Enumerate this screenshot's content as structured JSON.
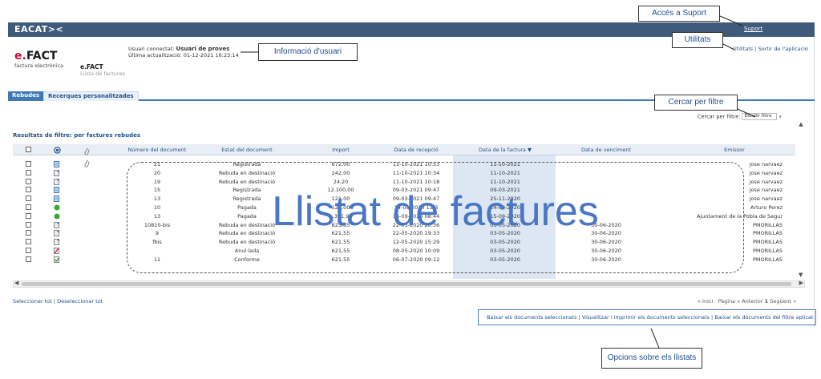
{
  "header": {
    "brand": "EACAT><",
    "support_link": "Suport"
  },
  "app": {
    "logo_main": "FACT",
    "logo_e": "e.",
    "logo_sub": "factura electrònica",
    "app_name": "e.FACT",
    "page_subtitle": "Llista de factures"
  },
  "user_info": {
    "connected_label": "Usuari connectat:",
    "connected_user": "Usuari de proves",
    "last_update_label": "Última actualització:",
    "last_update_value": "01-12-2021 16:23:14"
  },
  "utilities": {
    "utilitats": "Utilitats",
    "separator": "|",
    "logout": "Sortir de l'aplicació"
  },
  "tabs": [
    {
      "label": "Rebudes"
    },
    {
      "label": "Recerques personalitzades"
    }
  ],
  "filter": {
    "label": "Cercar per filtre:",
    "selected": "Escollir filtre"
  },
  "results_title": "Resultats de filtre: per factures rebudes",
  "table": {
    "columns": [
      "Número del document",
      "Estat del document",
      "Import",
      "Data de recepció",
      "Data de la factura",
      "Data de venciment",
      "Emissor"
    ],
    "sort_indicator": "▼",
    "rows": [
      {
        "num": "21",
        "estat": "Registrada",
        "import": "672,00",
        "recepcio": "11-10-2021 10:53",
        "factura": "11-10-2021",
        "venciment": "",
        "emissor": "jose narvaez"
      },
      {
        "num": "20",
        "estat": "Rebuda en destinació",
        "import": "242,00",
        "recepcio": "11-10-2021 10:34",
        "factura": "11-10-2021",
        "venciment": "",
        "emissor": "jose narvaez"
      },
      {
        "num": "19",
        "estat": "Rebuda en destinació",
        "import": "24,20",
        "recepcio": "11-10-2021 10:18",
        "factura": "11-10-2021",
        "venciment": "",
        "emissor": "jose narvaez"
      },
      {
        "num": "15",
        "estat": "Registrada",
        "import": "12.100,00",
        "recepcio": "09-03-2021 09:47",
        "factura": "09-03-2021",
        "venciment": "",
        "emissor": "jose narvaez"
      },
      {
        "num": "13",
        "estat": "Registrada",
        "import": "121,00",
        "recepcio": "09-03-2021 09:47",
        "factura": "25-11-2020",
        "venciment": "",
        "emissor": "jose narvaez"
      },
      {
        "num": "10",
        "estat": "Pagada",
        "import": "121,00",
        "recepcio": "14-09-2020 11:3",
        "factura": "14-09-2020",
        "venciment": "",
        "emissor": "Arturo Perez"
      },
      {
        "num": "13",
        "estat": "Pagada",
        "import": "1.331,92",
        "recepcio": "16-09-2020 08:44",
        "factura": "15-09-2020",
        "venciment": "",
        "emissor": "Ajuntament de la Pobla de Segur"
      },
      {
        "num": "10810-bis",
        "estat": "Rebuda en destinació",
        "import": "823,85",
        "recepcio": "22-05-2020 20:36",
        "factura": "03-05-2020",
        "venciment": "30-06-2020",
        "emissor": "PMORILLAS"
      },
      {
        "num": "9",
        "estat": "Rebuda en destinació",
        "import": "621,55",
        "recepcio": "22-05-2020 19:33",
        "factura": "03-05-2020",
        "venciment": "30-06-2020",
        "emissor": "PMORILLAS"
      },
      {
        "num": "fbis",
        "estat": "Rebuda en destinació",
        "import": "621,55",
        "recepcio": "12-05-2020 15:29",
        "factura": "03-05-2020",
        "venciment": "30-06-2020",
        "emissor": "PMORILLAS"
      },
      {
        "num": "",
        "estat": "Anul·lada",
        "import": "621,55",
        "recepcio": "08-05-2020 10:09",
        "factura": "03-05-2020",
        "venciment": "30-06-2020",
        "emissor": "PMORILLAS"
      },
      {
        "num": "11",
        "estat": "Conforme",
        "import": "621,55",
        "recepcio": "06-07-2020 09:12",
        "factura": "03-05-2020",
        "venciment": "30-06-2020",
        "emissor": "PMORILLAS"
      }
    ],
    "row_icons": [
      "doc-blue-icon",
      "doc-gray-icon",
      "doc-gray-icon",
      "doc-blue-icon",
      "doc-blue-icon",
      "green-status-icon",
      "green-status-icon",
      "doc-gray-icon",
      "doc-gray-icon",
      "doc-gray-icon",
      "cancelled-icon",
      "conform-check-icon"
    ]
  },
  "selection": {
    "select_all": "Seleccionar tot",
    "separator": "|",
    "deselect_all": "Deseleccionar tot"
  },
  "pager": {
    "first": "« Inici",
    "page_label": "Pàgina",
    "prev": "« Anterior",
    "current": "1",
    "next": "Següent »"
  },
  "list_options": {
    "download_selected": "Baixar els documents seleccionats",
    "sep1": "|",
    "view_print": "Visualitzar i imprimir els documents seleccionats",
    "sep2": "|",
    "download_filter": "Baixar els documents del filtre aplicat"
  },
  "annotations": {
    "support": "Accés a Suport",
    "utilities": "Utilitats",
    "user_info": "Informació d'usuari",
    "filter": "Cercar per filtre",
    "list_title": "Llistat de factures",
    "options": "Opcions sobre els llistats"
  },
  "colors": {
    "topbar": "#3f5a7a",
    "accent": "#1f4f8f",
    "tab_active": "#3f7ab5",
    "annotation_text": "#4a76c4"
  }
}
